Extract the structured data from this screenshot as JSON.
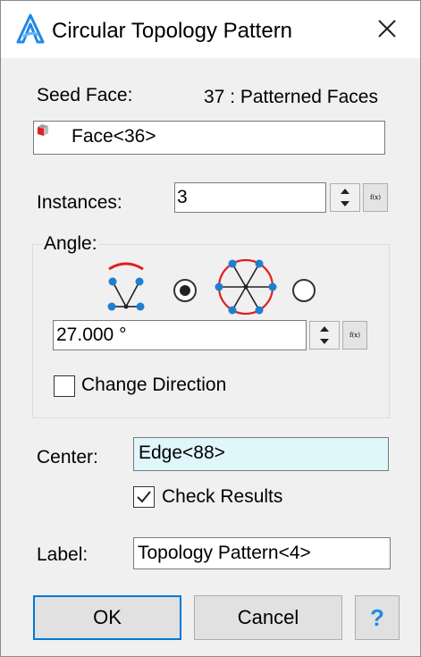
{
  "dialog": {
    "title": "Circular Topology Pattern",
    "seed_face": {
      "label": "Seed Face:",
      "count_text": "37 : Patterned Faces",
      "value": "Face<36>"
    },
    "instances": {
      "label": "Instances:",
      "value": "3",
      "fx_label": "f(x)"
    },
    "angle": {
      "group_label": "Angle:",
      "mode_selected": "partial-arc",
      "value": "27.000 °",
      "fx_label": "f(x)",
      "change_direction_label": "Change Direction",
      "change_direction_checked": false
    },
    "center": {
      "label": "Center:",
      "value": "Edge<88>"
    },
    "check_results": {
      "label": "Check Results",
      "checked": true
    },
    "label_field": {
      "label": "Label:",
      "value": "Topology Pattern<4>"
    },
    "buttons": {
      "ok": "OK",
      "cancel": "Cancel",
      "help": "?"
    },
    "colors": {
      "accent": "#0078d7",
      "node_blue": "#1e7fd0",
      "arc_red": "#e02020",
      "selected_field_bg": "#dff6fb"
    }
  }
}
